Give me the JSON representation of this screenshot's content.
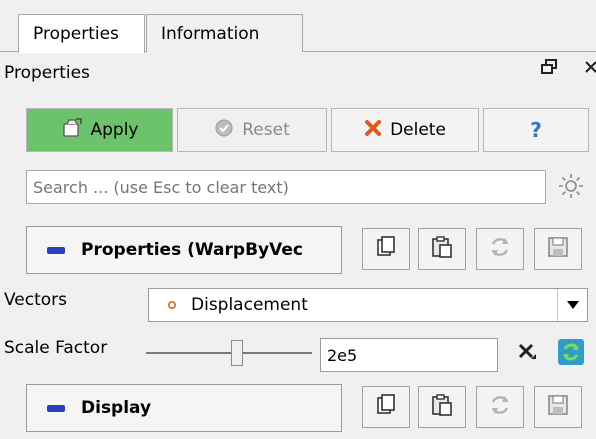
{
  "tabs": [
    {
      "label": "Properties",
      "active": true
    },
    {
      "label": "Information",
      "active": false
    }
  ],
  "panel": {
    "title": "Properties"
  },
  "toolbar": {
    "apply_label": "Apply",
    "reset_label": "Reset",
    "delete_label": "Delete",
    "help_label": "?"
  },
  "search": {
    "placeholder": "Search ... (use Esc to clear text)"
  },
  "sections": {
    "properties": {
      "label": "Properties (WarpByVec"
    },
    "display": {
      "label": "Display"
    }
  },
  "fields": {
    "vectors": {
      "label": "Vectors",
      "value": "Displacement"
    },
    "scale_factor": {
      "label": "Scale Factor",
      "value": "2e5",
      "slider_fraction": 0.55
    }
  },
  "colors": {
    "apply_bg": "#6cc36c",
    "section_dash": "#2a3fbf",
    "delete_x": "#e05a1e",
    "help": "#2a78c6"
  },
  "icons": [
    "apply-icon",
    "reset-icon",
    "delete-icon",
    "help-icon",
    "gear-icon",
    "copy-icon",
    "paste-icon",
    "reload-icon",
    "save-icon",
    "dropdown-arrow-icon",
    "clear-icon",
    "reset-to-default-icon"
  ]
}
